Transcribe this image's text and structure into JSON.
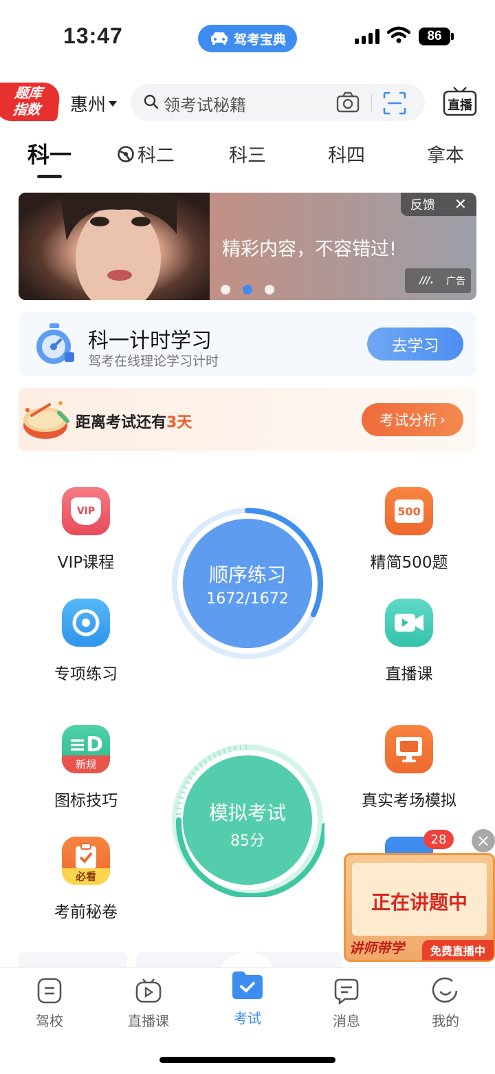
{
  "status_bar": {
    "time": "13:47",
    "app_pill": "驾考宝典",
    "battery": "86"
  },
  "header": {
    "badge_line1": "题库",
    "badge_line2": "指数",
    "city": "惠州",
    "search_placeholder": "领考试秘籍",
    "live_label": "直播"
  },
  "tabs": [
    {
      "label": "科一",
      "active": true
    },
    {
      "label": "科二"
    },
    {
      "label": "科三"
    },
    {
      "label": "科四"
    },
    {
      "label": "拿本"
    }
  ],
  "banner": {
    "text": "精彩内容，不容错过!",
    "feedback": "反馈",
    "ad_label": "广告",
    "active_dot": 1
  },
  "timer_card": {
    "title": "科一计时学习",
    "subtitle": "驾考在线理论学习计时",
    "button": "去学习"
  },
  "exam_card": {
    "text_prefix": "距离考试还有",
    "days": "3天",
    "button": "考试分析"
  },
  "features": {
    "vip": "VIP课程",
    "jingjian": "精简500题",
    "zhuanxiang": "专项练习",
    "zhibo": "直播课",
    "tubiao": "图标技巧",
    "zhenshi": "真实考场模拟",
    "kaoqian": "考前秘卷",
    "vip_badge": "VIP",
    "jingjian_badge": "500",
    "tubiao_badge": "新规",
    "kaoqian_badge": "必看"
  },
  "practice_circle": {
    "title": "顺序练习",
    "progress": "1672/1672",
    "fraction": 1.0
  },
  "mock_circle": {
    "title": "模拟考试",
    "score": "85分"
  },
  "float_live": {
    "title": "正在讲题中",
    "left_tag": "讲师带学",
    "right_tag": "免费直播中",
    "count": "28"
  },
  "bottom_nav": [
    {
      "label": "驾校"
    },
    {
      "label": "直播课"
    },
    {
      "label": "考试",
      "active": true
    },
    {
      "label": "消息"
    },
    {
      "label": "我的"
    }
  ],
  "colors": {
    "accent": "#3d8cf0",
    "orange": "#f05a28",
    "green": "#5ccfb0"
  }
}
